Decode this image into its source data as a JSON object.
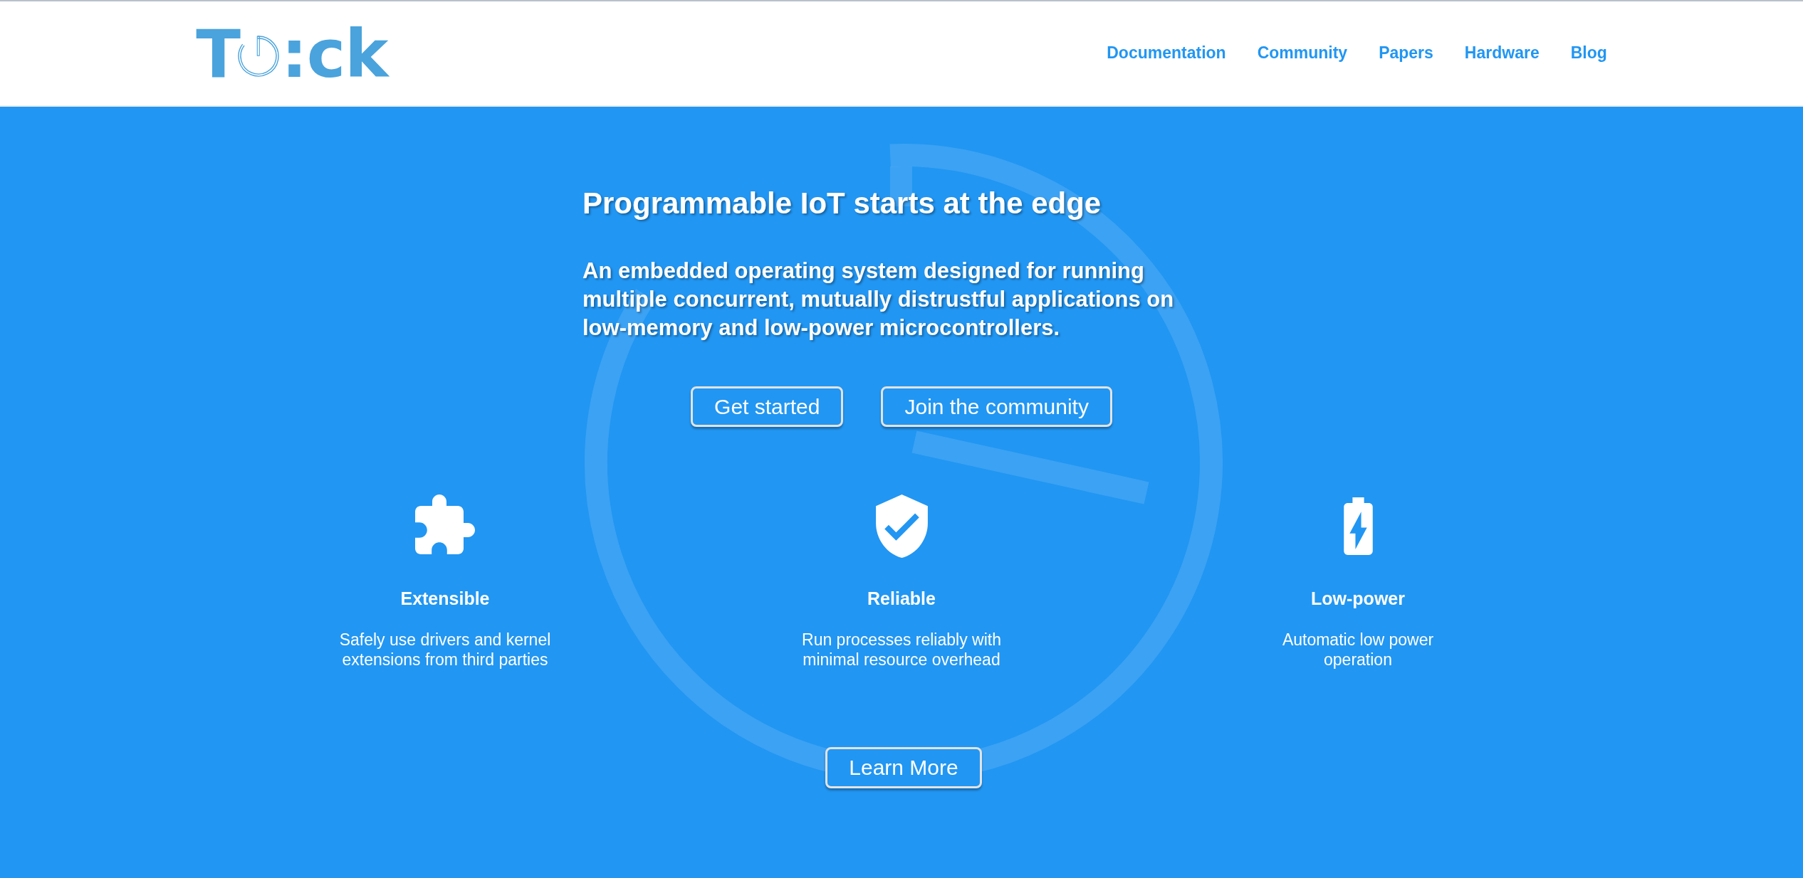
{
  "logo": {
    "lead": "T",
    "tail": ":ck"
  },
  "nav": [
    "Documentation",
    "Community",
    "Papers",
    "Hardware",
    "Blog"
  ],
  "hero": {
    "title": "Programmable IoT starts at the edge",
    "subtitle": "An embedded operating system designed for running multiple concurrent, mutually distrustful applications on low-memory and low-power microcontrollers.",
    "buttons": [
      "Get started",
      "Join the community"
    ]
  },
  "features": [
    {
      "title": "Extensible",
      "description": "Safely use drivers and kernel extensions from third parties"
    },
    {
      "title": "Reliable",
      "description": "Run processes reliably with minimal resource overhead"
    },
    {
      "title": "Low-power",
      "description": "Automatic low power operation"
    }
  ],
  "learn_more": "Learn More"
}
